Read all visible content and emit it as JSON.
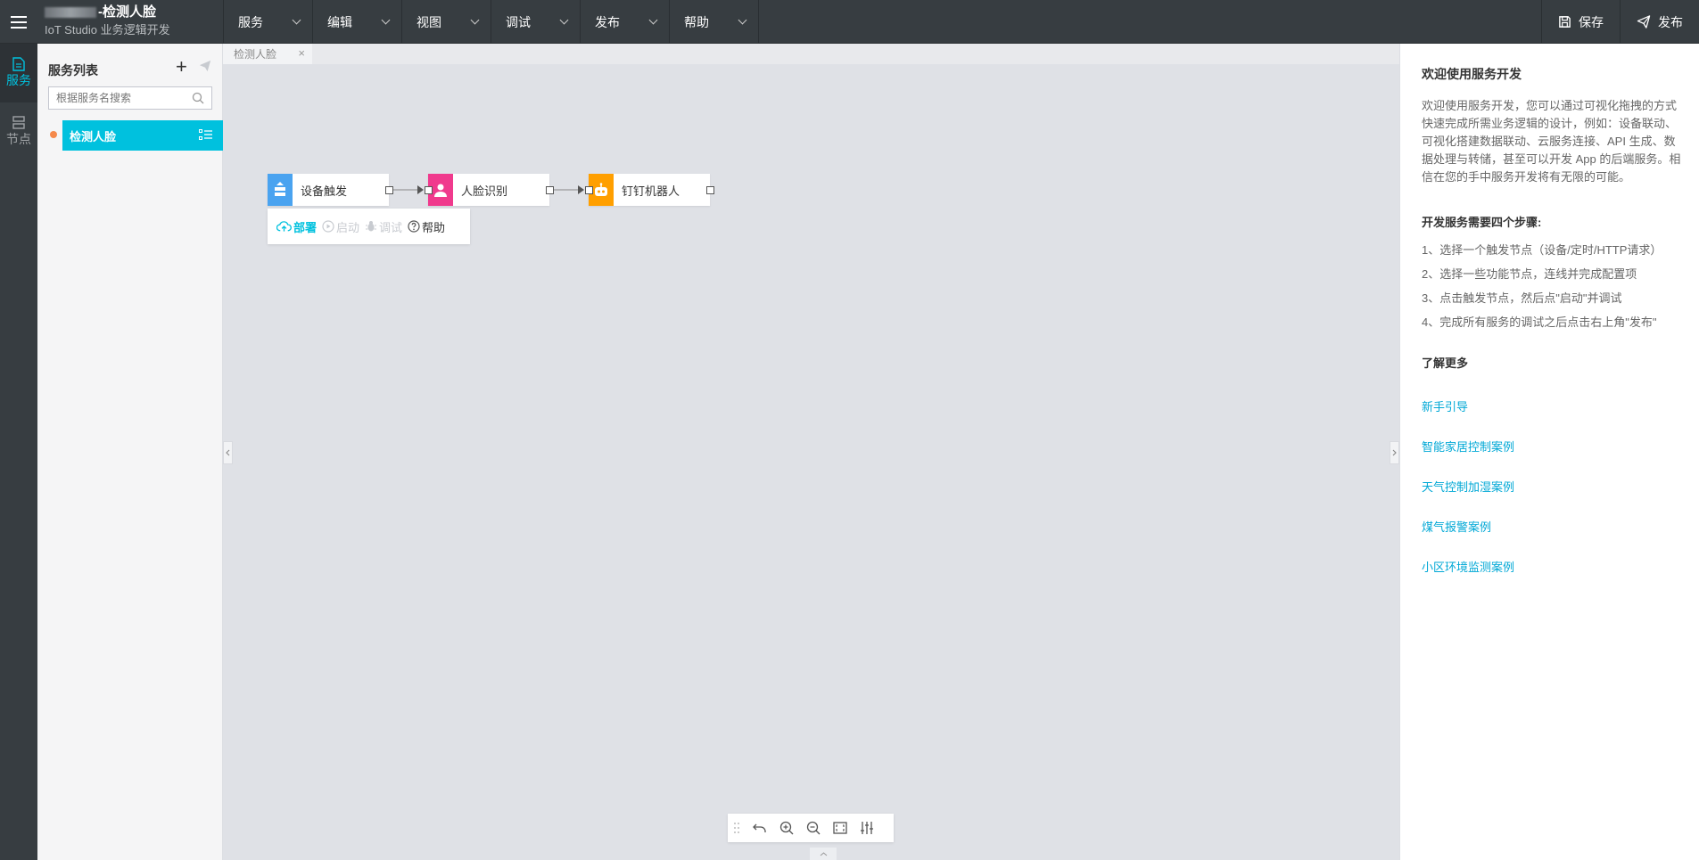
{
  "topbar": {
    "title_suffix": "-检测人脸",
    "subtitle": "IoT Studio 业务逻辑开发",
    "menu": [
      {
        "label": "服务"
      },
      {
        "label": "编辑"
      },
      {
        "label": "视图"
      },
      {
        "label": "调试"
      },
      {
        "label": "发布"
      },
      {
        "label": "帮助"
      }
    ],
    "save_label": "保存",
    "publish_label": "发布"
  },
  "iconbar": {
    "service_label": "服务",
    "node_label": "节点"
  },
  "service_panel": {
    "header": "服务列表",
    "search_placeholder": "根据服务名搜索",
    "items": [
      {
        "label": "检测人脸",
        "status_color": "#f5894b"
      }
    ]
  },
  "canvas": {
    "tab_label": "检测人脸",
    "tab_close": "×",
    "nodes": [
      {
        "label": "设备触发",
        "color": "#4aa3f0"
      },
      {
        "label": "人脸识别",
        "color": "#f03a8d"
      },
      {
        "label": "钉钉机器人",
        "color": "#ff9f00"
      }
    ],
    "toolbar": {
      "deploy": "部署",
      "start": "启动",
      "debug": "调试",
      "help": "帮助"
    }
  },
  "help_panel": {
    "title": "欢迎使用服务开发",
    "intro": "欢迎使用服务开发，您可以通过可视化拖拽的方式快速完成所需业务逻辑的设计，例如：设备联动、可视化搭建数据联动、云服务连接、API 生成、数据处理与转储，甚至可以开发 App 的后端服务。相信在您的手中服务开发将有无限的可能。",
    "steps_title": "开发服务需要四个步骤:",
    "steps": [
      "1、选择一个触发节点（设备/定时/HTTP请求）",
      "2、选择一些功能节点，连线并完成配置项",
      "3、点击触发节点，然后点\"启动\"并调试",
      "4、完成所有服务的调试之后点击右上角\"发布\""
    ],
    "more_title": "了解更多",
    "links": [
      "新手引导",
      "智能家居控制案例",
      "天气控制加湿案例",
      "煤气报警案例",
      "小区环境监测案例"
    ]
  },
  "colors": {
    "accent": "#00c1de",
    "topbar": "#373d41",
    "link": "#00a8d6"
  }
}
